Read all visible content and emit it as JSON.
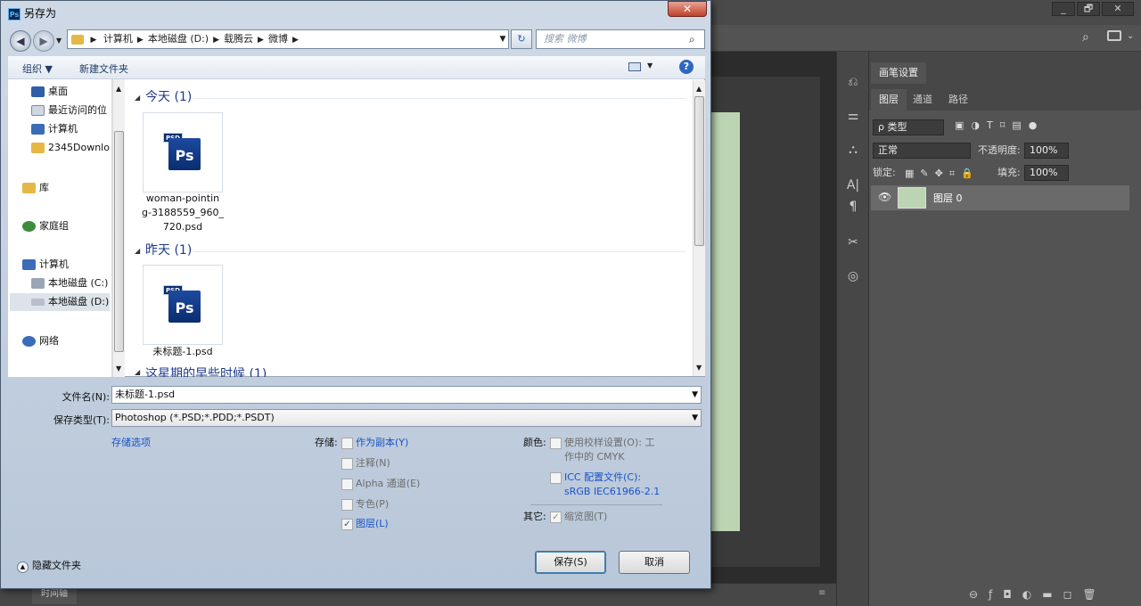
{
  "photoshop": {
    "top_bar": {
      "minimize": "_",
      "restore": "🗗",
      "close": "✕"
    },
    "timeline_tab": "时间轴",
    "panel_tabs": {
      "brush_settings": "画笔设置",
      "layers": "图层",
      "channels": "通道",
      "paths": "路径"
    },
    "layer_filter": "ρ 类型",
    "blend_mode": "正常",
    "opacity_label": "不透明度:",
    "opacity_value": "100%",
    "lock_label": "锁定:",
    "fill_label": "填充:",
    "fill_value": "100%",
    "layer_name": "图层 0"
  },
  "dialog": {
    "title": "另存为",
    "close_glyph": "✕",
    "breadcrumb": [
      "计算机",
      "本地磁盘 (D:)",
      "载腾云",
      "微博"
    ],
    "search_placeholder": "搜索 微博",
    "toolbar": {
      "organize": "组织 ▼",
      "new_folder": "新建文件夹"
    },
    "nav_items": [
      {
        "label": "桌面"
      },
      {
        "label": "最近访问的位"
      },
      {
        "label": "计算机"
      },
      {
        "label": "2345Downlo"
      },
      {
        "label": "库"
      },
      {
        "label": "家庭组"
      },
      {
        "label": "计算机"
      },
      {
        "label": "本地磁盘 (C:)"
      },
      {
        "label": "本地磁盘 (D:)"
      },
      {
        "label": "网络"
      }
    ],
    "groups": [
      {
        "header": "今天 (1)",
        "file": "woman-pointing-3188559_960_720.psd",
        "file_lines": [
          "woman-pointin",
          "g-3188559_960_",
          "720.psd"
        ]
      },
      {
        "header": "昨天 (1)",
        "file": "未标题-1.psd",
        "file_lines": [
          "未标题-1.psd"
        ]
      }
    ],
    "partial_group_header": "这星期的早些时候 (1)",
    "psd_badge": "PSD",
    "ps_logo": "Ps",
    "filename_label": "文件名(N):",
    "filename_value": "未标题-1.psd",
    "savetype_label": "保存类型(T):",
    "savetype_value": "Photoshop (*.PSD;*.PDD;*.PSDT)",
    "save_options_link": "存储选项",
    "storage_label": "存储:",
    "storage_options": [
      {
        "label": "作为副本(Y)",
        "checked": false,
        "link": true
      },
      {
        "label": "注释(N)",
        "checked": false,
        "link": false
      },
      {
        "label": "Alpha 通道(E)",
        "checked": false,
        "link": false
      },
      {
        "label": "专色(P)",
        "checked": false,
        "link": false
      },
      {
        "label": "图层(L)",
        "checked": true,
        "link": true
      }
    ],
    "color_label": "颜色:",
    "proof_setup": {
      "line1": "使用校样设置(O): 工",
      "line2": "作中的 CMYK"
    },
    "icc_profile": {
      "line1": "ICC 配置文件(C):",
      "line2": "sRGB IEC61966-2.1"
    },
    "other_label": "其它:",
    "thumbnail_label": "缩览图(T)",
    "hide_folders": "隐藏文件夹",
    "save_button": "保存(S)",
    "cancel_button": "取消"
  },
  "colors": {
    "ps_bg": "#535353",
    "canvas": "#bdd4b2",
    "link": "#1a53c7",
    "dialog_frame": "#b8c7d9"
  }
}
